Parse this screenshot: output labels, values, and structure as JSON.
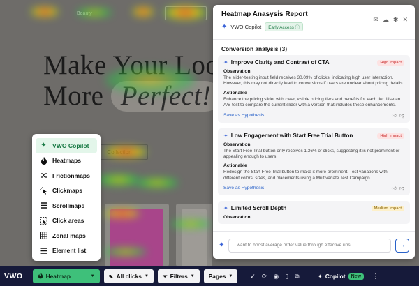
{
  "site": {
    "nav": [
      "",
      "",
      "",
      "Beauty"
    ],
    "headline_line1": "Make Your Look",
    "headline_line2_prefix": "More",
    "headline_line2_pill": "Perfect!",
    "collection_label": "Collection"
  },
  "map_menu": {
    "items": [
      {
        "label": "VWO Copilot",
        "icon": "sparkle-icon"
      },
      {
        "label": "Heatmaps",
        "icon": "flame-icon"
      },
      {
        "label": "Frictionmaps",
        "icon": "friction-icon"
      },
      {
        "label": "Clickmaps",
        "icon": "click-icon"
      },
      {
        "label": "Scrollmaps",
        "icon": "scroll-icon"
      },
      {
        "label": "Click areas",
        "icon": "click-area-icon"
      },
      {
        "label": "Zonal maps",
        "icon": "grid-icon"
      },
      {
        "label": "Element list",
        "icon": "list-icon"
      }
    ]
  },
  "report": {
    "title": "Heatmap Anasysis Report",
    "copilot_label": "VWO Copilot",
    "early_access": "Early Access",
    "section_title": "Conversion analysis (3)",
    "insights": [
      {
        "title": "Improve Clarity and Contrast of CTA",
        "impact": "High impact",
        "observation_label": "Observation",
        "observation": "The slider-testing input field receives 30.09% of clicks, indicating high user interaction. However, this may not directly lead to conversions if users are unclear about pricing details.",
        "actionable_label": "Actionable",
        "actionable": "Enhance the pricing slider with clear, visible pricing tiers and benefits for each tier. Use an A/B test to compare the current slider with a version that includes these enhancements.",
        "save_label": "Save as Hypothesis"
      },
      {
        "title": "Low Engagement with Start Free Trial Button",
        "impact": "High impact",
        "observation_label": "Observation",
        "observation": "The Start Free Trial button only receives 1.36% of clicks, suggesting it is not prominent or appealing enough to users.",
        "actionable_label": "Actionable",
        "actionable": "Redesign the Start Free Trial button to make it more prominent. Test variations with different colors, sizes, and placements using a Multivariate Test Campaign.",
        "save_label": "Save as Hypothesis"
      },
      {
        "title": "Limited Scroll Depth",
        "impact": "Medium impact",
        "observation_label": "Observation"
      }
    ],
    "prompt_placeholder": "I want to boost average order value through effective ups"
  },
  "toolbar": {
    "logo": "VWO",
    "heatmap_label": "Heatmap",
    "clicks_label": "All clicks",
    "filters_label": "Filters",
    "pages_label": "Pages",
    "copilot_label": "Copilot",
    "new_badge": "New"
  },
  "colors": {
    "accent_green": "#3ec07a",
    "toolbar_bg": "#161a3a",
    "link_blue": "#2a62c9",
    "high_impact": "#c33333",
    "medium_impact": "#8a6300"
  }
}
